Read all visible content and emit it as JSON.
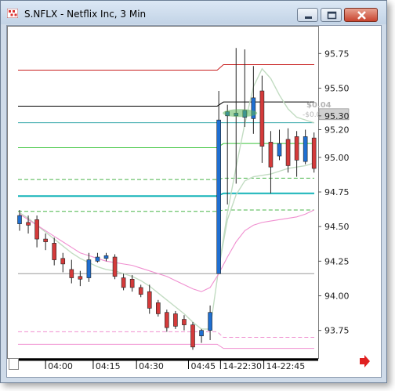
{
  "window": {
    "title": "S.NFLX - Netflix Inc, 3 Min",
    "buttons": [
      "minimize",
      "maximize",
      "close"
    ]
  },
  "colors": {
    "up_candle": "#1f6fd1",
    "down_candle": "#d43a3a",
    "line_red": "#c81e1e",
    "line_black": "#000000",
    "line_teal": "#2fa5a8",
    "line_green": "#3ec53e",
    "line_dashed_green": "#49b549",
    "line_cyan": "#14b3b8",
    "band_light_green": "#c2dcc2",
    "band_pink": "#f08fd0",
    "scroll_arrow": "#e02020"
  },
  "price_axis": {
    "labels": [
      "95.75",
      "95.50",
      "95.30",
      "95.20",
      "95.00",
      "94.75",
      "94.50",
      "94.25",
      "94.00",
      "93.75"
    ],
    "highlight_label": "95.30",
    "ylim": [
      93.55,
      95.95
    ]
  },
  "time_axis": {
    "labels": [
      "04:00",
      "04:15",
      "04:30",
      "04:45",
      "14-22:30",
      "14-22:45"
    ]
  },
  "annotations": {
    "tag1": "$0.04",
    "tag2": "-$0.04 9"
  },
  "navigation": {
    "scroll_icon": "scroll-right-arrow-icon"
  },
  "chart_data": {
    "type": "candlestick",
    "candles": [
      {
        "open": 94.52,
        "close": 94.58,
        "high": 94.62,
        "low": 94.47,
        "dir": "up"
      },
      {
        "open": 94.53,
        "close": 94.51,
        "high": 94.58,
        "low": 94.45,
        "dir": "down"
      },
      {
        "open": 94.55,
        "close": 94.41,
        "high": 94.58,
        "low": 94.35,
        "dir": "down"
      },
      {
        "open": 94.41,
        "close": 94.39,
        "high": 94.45,
        "low": 94.33,
        "dir": "down"
      },
      {
        "open": 94.38,
        "close": 94.26,
        "high": 94.42,
        "low": 94.22,
        "dir": "down"
      },
      {
        "open": 94.27,
        "close": 94.23,
        "high": 94.31,
        "low": 94.17,
        "dir": "down"
      },
      {
        "open": 94.19,
        "close": 94.13,
        "high": 94.26,
        "low": 94.09,
        "dir": "down"
      },
      {
        "open": 94.14,
        "close": 94.12,
        "high": 94.18,
        "low": 94.07,
        "dir": "down"
      },
      {
        "open": 94.13,
        "close": 94.26,
        "high": 94.31,
        "low": 94.1,
        "dir": "up"
      },
      {
        "open": 94.25,
        "close": 94.28,
        "high": 94.31,
        "low": 94.24,
        "dir": "up"
      },
      {
        "open": 94.27,
        "close": 94.29,
        "high": 94.31,
        "low": 94.25,
        "dir": "up"
      },
      {
        "open": 94.28,
        "close": 94.14,
        "high": 94.3,
        "low": 94.12,
        "dir": "down"
      },
      {
        "open": 94.13,
        "close": 94.06,
        "high": 94.16,
        "low": 94.04,
        "dir": "down"
      },
      {
        "open": 94.12,
        "close": 94.06,
        "high": 94.15,
        "low": 94.03,
        "dir": "down"
      },
      {
        "open": 94.06,
        "close": 94.01,
        "high": 94.08,
        "low": 93.99,
        "dir": "down"
      },
      {
        "open": 94.03,
        "close": 93.91,
        "high": 94.08,
        "low": 93.87,
        "dir": "down"
      },
      {
        "open": 93.95,
        "close": 93.87,
        "high": 93.97,
        "low": 93.85,
        "dir": "down"
      },
      {
        "open": 93.88,
        "close": 93.77,
        "high": 93.9,
        "low": 93.74,
        "dir": "down"
      },
      {
        "open": 93.87,
        "close": 93.78,
        "high": 93.89,
        "low": 93.76,
        "dir": "down"
      },
      {
        "open": 93.83,
        "close": 93.79,
        "high": 93.86,
        "low": 93.75,
        "dir": "down"
      },
      {
        "open": 93.79,
        "close": 93.63,
        "high": 93.81,
        "low": 93.61,
        "dir": "down"
      },
      {
        "open": 93.71,
        "close": 93.75,
        "high": 93.76,
        "low": 93.66,
        "dir": "up"
      },
      {
        "open": 93.75,
        "close": 93.88,
        "high": 93.93,
        "low": 93.68,
        "dir": "up"
      },
      {
        "open": 94.16,
        "close": 95.27,
        "high": 95.48,
        "low": 94.16,
        "dir": "up"
      },
      {
        "open": 95.3,
        "close": 95.33,
        "high": 95.38,
        "low": 94.66,
        "dir": "up"
      },
      {
        "open": 95.3,
        "close": 95.32,
        "high": 95.79,
        "low": 94.81,
        "dir": "up"
      },
      {
        "open": 95.29,
        "close": 95.34,
        "high": 95.78,
        "low": 95.22,
        "dir": "up"
      },
      {
        "open": 95.28,
        "close": 95.43,
        "high": 95.66,
        "low": 95.17,
        "dir": "up"
      },
      {
        "open": 95.48,
        "close": 95.08,
        "high": 95.59,
        "low": 94.96,
        "dir": "down"
      },
      {
        "open": 95.11,
        "close": 94.93,
        "high": 95.19,
        "low": 94.74,
        "dir": "down"
      },
      {
        "open": 95.1,
        "close": 95.01,
        "high": 95.2,
        "low": 94.98,
        "dir": "up"
      },
      {
        "open": 95.13,
        "close": 94.94,
        "high": 95.21,
        "low": 94.89,
        "dir": "down"
      },
      {
        "open": 95.15,
        "close": 94.98,
        "high": 95.19,
        "low": 94.86,
        "dir": "down"
      },
      {
        "open": 94.97,
        "close": 95.15,
        "high": 95.2,
        "low": 94.95,
        "dir": "up"
      },
      {
        "open": 95.14,
        "close": 94.92,
        "high": 95.18,
        "low": 94.89,
        "dir": "down"
      }
    ],
    "levels": [
      {
        "name": "red-level",
        "before": 95.63,
        "after": 95.67,
        "style": "solid",
        "color": "line_red"
      },
      {
        "name": "black-level",
        "before": 95.37,
        "after": 95.4,
        "style": "solid",
        "color": "line_black"
      },
      {
        "name": "teal-level",
        "before": 95.25,
        "after": 95.25,
        "style": "solid",
        "color": "line_teal"
      },
      {
        "name": "green-level",
        "before": 95.07,
        "after": 95.1,
        "style": "solid",
        "color": "line_green"
      },
      {
        "name": "green-dashed-upper",
        "before": 94.84,
        "after": 94.85,
        "style": "dashed",
        "color": "line_dashed_green"
      },
      {
        "name": "cyan-level",
        "before": 94.72,
        "after": 94.74,
        "style": "solid",
        "color": "line_cyan"
      },
      {
        "name": "green-dashed-lower",
        "before": 94.61,
        "after": 94.62,
        "style": "dashed",
        "color": "line_dashed_green"
      },
      {
        "name": "gray-level",
        "before": 94.16,
        "after": 94.16,
        "style": "solid",
        "color": "#999999"
      },
      {
        "name": "pink-dashed",
        "before": 93.74,
        "after": 93.7,
        "style": "dashed",
        "color": "band_pink"
      },
      {
        "name": "pink-solid",
        "before": 93.65,
        "after": 93.62,
        "style": "solid",
        "color": "band_pink"
      }
    ],
    "light_green_band": [
      94.6,
      94.56,
      94.51,
      94.46,
      94.41,
      94.36,
      94.31,
      94.27,
      94.24,
      94.21,
      94.19,
      94.18,
      94.16,
      94.14,
      94.11,
      94.07,
      94.02,
      93.97,
      93.92,
      93.87,
      93.81,
      93.76,
      93.76,
      94.2,
      94.6,
      94.93,
      95.24,
      95.51,
      95.64,
      95.57,
      95.45,
      95.35,
      95.29,
      95.27,
      95.25
    ],
    "pink_band": [
      94.59,
      94.55,
      94.51,
      94.47,
      94.43,
      94.39,
      94.35,
      94.31,
      94.29,
      94.27,
      94.25,
      94.24,
      94.23,
      94.22,
      94.2,
      94.18,
      94.16,
      94.14,
      94.11,
      94.08,
      94.05,
      94.03,
      94.06,
      94.16,
      94.28,
      94.39,
      94.47,
      94.51,
      94.53,
      94.54,
      94.55,
      94.56,
      94.57,
      94.59,
      94.62
    ],
    "light_green_band_2": [
      null,
      null,
      null,
      null,
      null,
      null,
      null,
      null,
      null,
      null,
      null,
      null,
      null,
      null,
      null,
      null,
      null,
      null,
      null,
      null,
      null,
      null,
      null,
      94.2,
      94.55,
      94.73,
      94.83,
      94.86,
      94.87,
      94.88,
      94.9,
      94.92,
      94.93,
      94.94,
      94.96
    ]
  }
}
